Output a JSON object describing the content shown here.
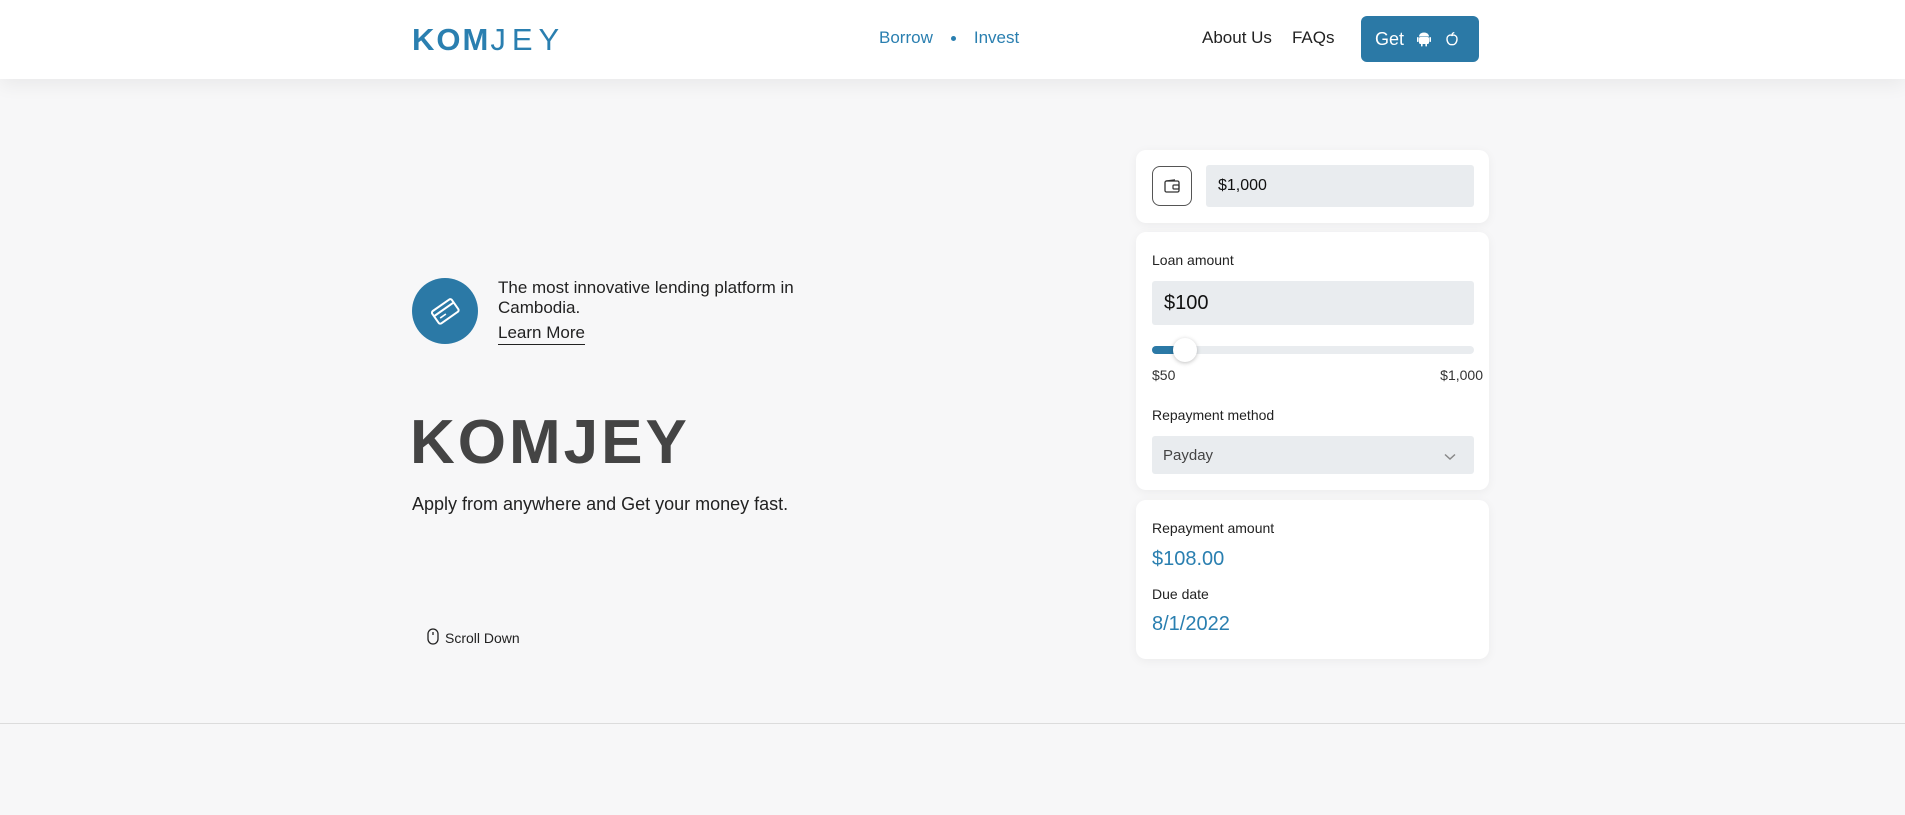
{
  "header": {
    "logo": {
      "part1": "KOM",
      "part2": "JEY"
    },
    "nav_center": [
      {
        "label": "Borrow"
      },
      {
        "label": "Invest"
      }
    ],
    "nav_right": [
      {
        "label": "About Us"
      },
      {
        "label": "FAQs"
      }
    ],
    "get_button": {
      "label": "Get",
      "icons": [
        "android-icon",
        "apple-icon"
      ]
    }
  },
  "hero": {
    "icon": "credit-card-icon",
    "tagline": "The most innovative lending platform in Cambodia.",
    "learn_more": "Learn More",
    "title": "KOMJEY",
    "subtitle": "Apply from anywhere and Get your money fast.",
    "scroll_down": "Scroll Down"
  },
  "calculator": {
    "max_amount_value": "$1,000",
    "loan_amount_label": "Loan amount",
    "loan_amount_value": "$100",
    "slider": {
      "min_label": "$50",
      "max_label": "$1,000",
      "min": 50,
      "max": 1000,
      "value": 100
    },
    "repayment_method_label": "Repayment method",
    "repayment_method_value": "Payday",
    "repayment_amount_label": "Repayment amount",
    "repayment_amount_value": "$108.00",
    "due_date_label": "Due date",
    "due_date_value": "8/1/2022"
  },
  "colors": {
    "accent": "#2b79a6",
    "link": "#2a7fb0",
    "input_bg": "#e9ecef"
  }
}
